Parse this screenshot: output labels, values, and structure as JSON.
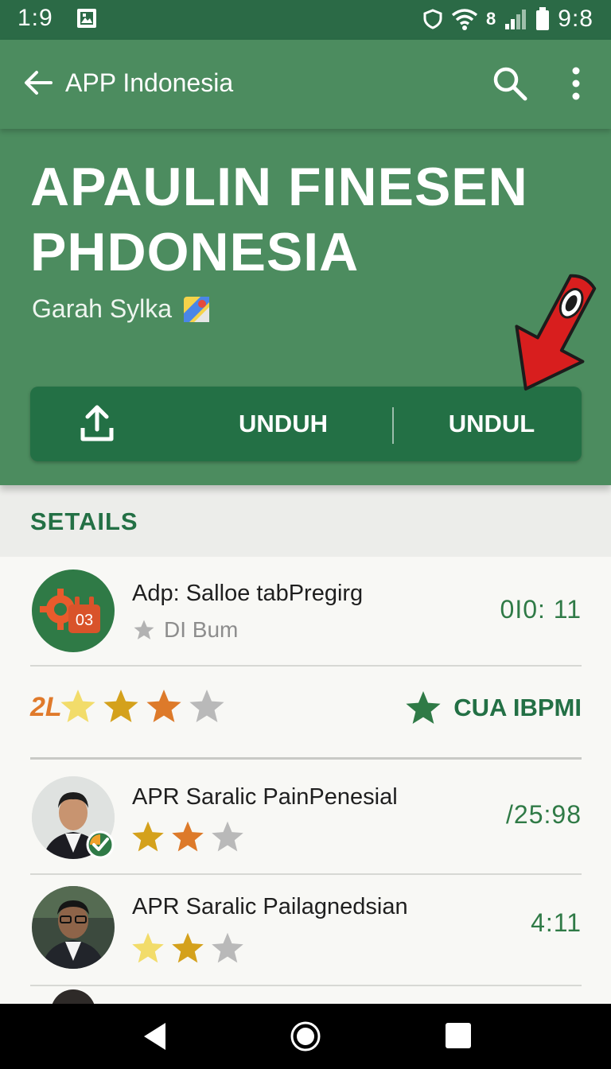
{
  "status_bar": {
    "time_left": "1:9",
    "time_right": "9:8",
    "carrier": "8",
    "icons": [
      "image-icon",
      "shield-icon",
      "wifi-icon",
      "signal-icon",
      "battery-icon"
    ]
  },
  "app_bar": {
    "title": "APP Indonesia",
    "icons": [
      "back-arrow-icon",
      "search-icon",
      "more-vert-icon"
    ]
  },
  "hero": {
    "headline": "APAULIN FINESEN PHDONESIA",
    "subtitle": "Garah Sylka",
    "subtitle_icon": "maps-icon",
    "actions": {
      "upload_icon": "upload-icon",
      "button_1": "UNDUH",
      "button_2": "UNDUL"
    },
    "pointer_icon": "red-arrow-pointer-icon"
  },
  "section": {
    "label": "SETAILS"
  },
  "list": {
    "app_row": {
      "title": "Adp: Salloe tabPregirg",
      "subtitle": "DI Bum",
      "value": "0I0: 11",
      "icon_badge": "03",
      "icon": "app-gear-icon"
    },
    "rating_row": {
      "prefix": "2L",
      "rating": 3,
      "max": 4,
      "badge_text": "CUA IBPMI",
      "badge_icon": "star-icon"
    },
    "people": [
      {
        "title": "APR Saralic PainPenesial",
        "value": "/25:98",
        "rating": 2,
        "max": 3,
        "verified": true
      },
      {
        "title": "APR Saralic Pailagnedsian",
        "value": "4:11",
        "rating": 2,
        "max": 3,
        "verified": false
      }
    ]
  },
  "colors": {
    "status_bar": "#2b6a46",
    "primary": "#4c8c5f",
    "primary_dark": "#237045",
    "accent_red": "#d81e1e",
    "star_yellow": "#f2dc6a",
    "star_gold": "#d4a11c",
    "star_orange": "#dd7a2a",
    "star_gray": "#b9b9b9"
  }
}
